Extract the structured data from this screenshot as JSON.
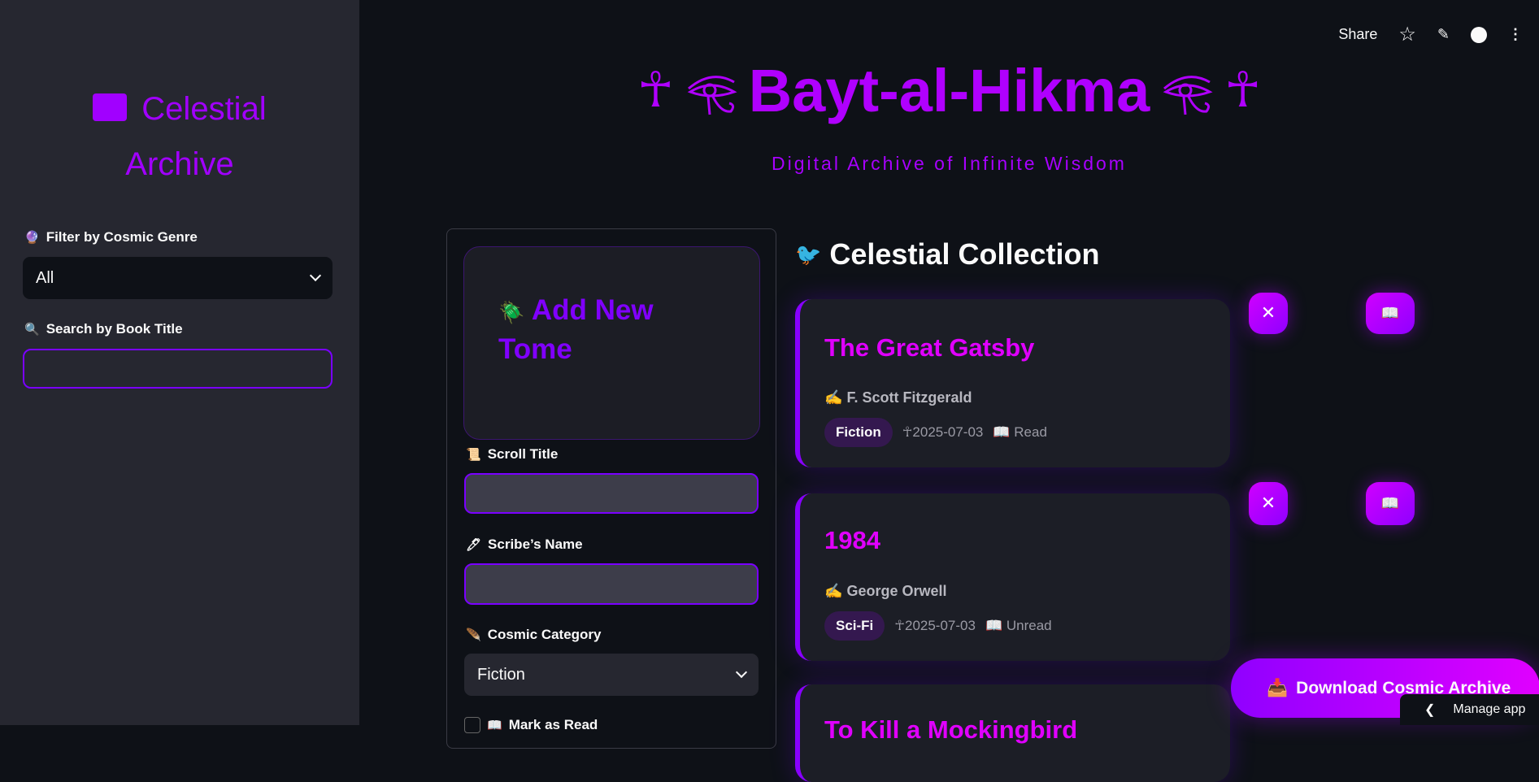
{
  "sidebar": {
    "title_line1": "Celestial",
    "title_line2": "Archive",
    "title_icon": "book-icon",
    "filter_label": "Filter by Cosmic Genre",
    "filter_icon": "crystal-ball-icon",
    "filter_value": "All",
    "search_label": "Search by Book Title",
    "search_icon": "magnifier-icon",
    "search_value": ""
  },
  "topbar": {
    "share": "Share",
    "icons": [
      "star-icon",
      "pencil-icon",
      "github-icon",
      "more-icon"
    ]
  },
  "header": {
    "title": "Bayt-al-Hikma",
    "subtitle": "Digital Archive of Infinite Wisdom"
  },
  "form": {
    "title": "Add New Tome",
    "title_icon": "scarab-icon",
    "scroll_label": "Scroll Title",
    "scroll_icon": "scroll-icon",
    "scribe_label": "Scribe’s Name",
    "scribe_icon": "pen-icon",
    "category_label": "Cosmic Category",
    "category_icon": "quill-icon",
    "category_value": "Fiction",
    "read_label": "Mark as Read"
  },
  "collection": {
    "heading": "Celestial Collection",
    "heading_icon": "bird-icon",
    "books": [
      {
        "title": "The Great Gatsby",
        "author": "F. Scott Fitzgerald",
        "genre": "Fiction",
        "date": "2025-07-03",
        "status": "Read"
      },
      {
        "title": "1984",
        "author": "George Orwell",
        "genre": "Sci-Fi",
        "date": "2025-07-03",
        "status": "Unread"
      },
      {
        "title": "To Kill a Mockingbird"
      }
    ]
  },
  "download_label": "Download Cosmic Archive",
  "manage_label": "Manage app",
  "glyphs": {
    "ankh": "☥",
    "close": "✕",
    "open_book": "📖",
    "author": "𓀀"
  },
  "colors": {
    "accent": "#a100ff",
    "title": "#e000ff",
    "bg": "#0e1117",
    "sidebar": "#262730"
  }
}
